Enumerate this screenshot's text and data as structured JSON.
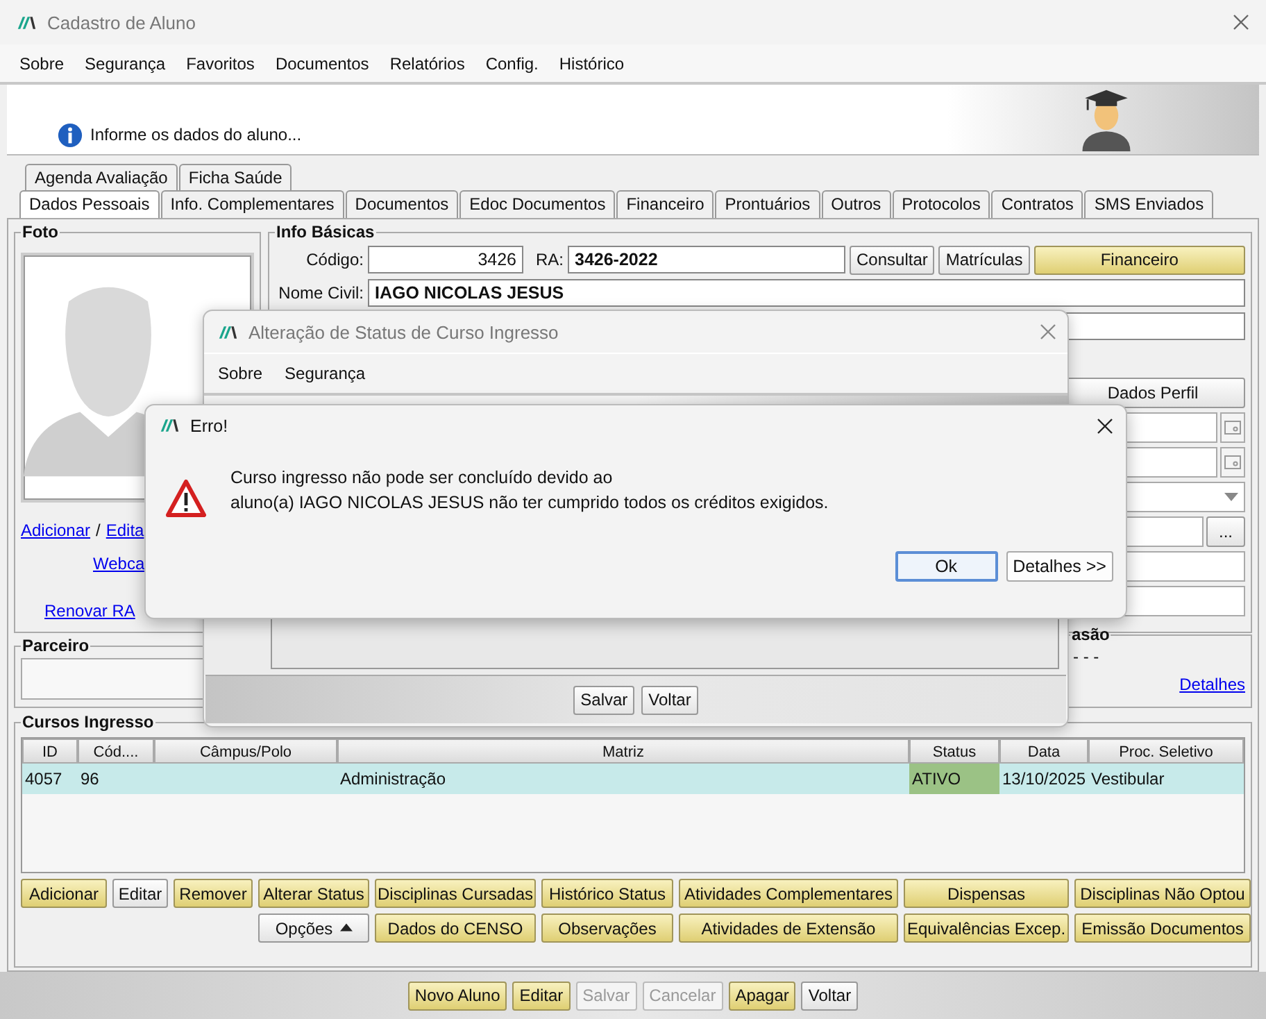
{
  "window": {
    "title": "Cadastro de Aluno"
  },
  "menu": [
    "Sobre",
    "Segurança",
    "Favoritos",
    "Documentos",
    "Relatórios",
    "Config.",
    "Histórico"
  ],
  "header": {
    "info": "Informe os dados do aluno..."
  },
  "tabs_row1": [
    {
      "label": "Agenda Avaliação",
      "selected": false
    },
    {
      "label": "Ficha Saúde",
      "selected": false
    }
  ],
  "tabs_row2": [
    {
      "label": "Dados Pessoais",
      "selected": true
    },
    {
      "label": "Info. Complementares",
      "selected": false
    },
    {
      "label": "Documentos",
      "selected": false
    },
    {
      "label": "Edoc Documentos",
      "selected": false
    },
    {
      "label": "Financeiro",
      "selected": false
    },
    {
      "label": "Prontuários",
      "selected": false
    },
    {
      "label": "Outros",
      "selected": false
    },
    {
      "label": "Protocolos",
      "selected": false
    },
    {
      "label": "Contratos",
      "selected": false
    },
    {
      "label": "SMS Enviados",
      "selected": false
    }
  ],
  "foto": {
    "title": "Foto",
    "link_add": "Adicionar",
    "separator": "/",
    "link_edit": "Edita",
    "link_webcam": "Webca",
    "link_renew": "Renovar RA"
  },
  "info_basicas": {
    "title": "Info Básicas",
    "codigo_label": "Código:",
    "codigo": "3426",
    "ra_label": "RA:",
    "ra": "3426-2022",
    "nome_label": "Nome Civil:",
    "nome": "IAGO NICOLAS JESUS",
    "buttons": [
      {
        "label": "Consultar",
        "kind": "plain"
      },
      {
        "label": "Matrículas",
        "kind": "plain"
      },
      {
        "label": "Financeiro",
        "kind": "yellow"
      }
    ]
  },
  "perfil": {
    "button": "Dados Perfil",
    "more": "...",
    "box_title": "asão",
    "value": "- - -",
    "link": "Detalhes"
  },
  "parceiro": {
    "title": "Parceiro"
  },
  "cursos": {
    "title": "Cursos Ingresso",
    "columns": [
      "ID",
      "Cód....",
      "Câmpus/Polo",
      "Matriz",
      "Status",
      "Data",
      "Proc. Seletivo"
    ],
    "rows": [
      {
        "cells": [
          "4057",
          "96",
          "",
          "Administração",
          "ATIVO",
          "13/10/2025",
          "Vestibular"
        ],
        "selected": true
      }
    ],
    "buttons_row1": [
      {
        "label": "Adicionar",
        "kind": "yellow"
      },
      {
        "label": "Editar",
        "kind": "plain"
      },
      {
        "label": "Remover",
        "kind": "yellow"
      },
      {
        "label": "Alterar Status",
        "kind": "yellow"
      },
      {
        "label": "Disciplinas Cursadas",
        "kind": "yellow"
      },
      {
        "label": "Histórico Status",
        "kind": "yellow"
      },
      {
        "label": "Atividades Complementares",
        "kind": "yellow"
      },
      {
        "label": "Dispensas",
        "kind": "yellow"
      },
      {
        "label": "Disciplinas Não Optou",
        "kind": "yellow"
      }
    ],
    "buttons_row2": [
      {
        "label": "Opções",
        "kind": "menu"
      },
      {
        "label": "Dados do CENSO",
        "kind": "yellow"
      },
      {
        "label": "Observações",
        "kind": "yellow"
      },
      {
        "label": "Atividades de Extensão",
        "kind": "yellow"
      },
      {
        "label": "Equivalências Excep.",
        "kind": "yellow"
      },
      {
        "label": "Emissão Documentos",
        "kind": "yellow"
      }
    ]
  },
  "footer_buttons": [
    {
      "label": "Novo Aluno",
      "kind": "yellow",
      "disabled": false
    },
    {
      "label": "Editar",
      "kind": "yellow",
      "disabled": false
    },
    {
      "label": "Salvar",
      "kind": "plain",
      "disabled": true
    },
    {
      "label": "Cancelar",
      "kind": "plain",
      "disabled": true
    },
    {
      "label": "Apagar",
      "kind": "yellow",
      "disabled": false
    },
    {
      "label": "Voltar",
      "kind": "plain",
      "disabled": false
    }
  ],
  "status_dialog": {
    "title": "Alteração de Status de Curso Ingresso",
    "menu": [
      "Sobre",
      "Segurança"
    ],
    "buttons": [
      "Salvar",
      "Voltar"
    ]
  },
  "error_dialog": {
    "title": "Erro!",
    "message": [
      "Curso ingresso não pode ser concluído devido ao",
      "aluno(a) IAGO NICOLAS JESUS não ter cumprido todos os créditos exigidos."
    ],
    "buttons": [
      {
        "label": "Ok",
        "default": true
      },
      {
        "label": "Detalhes >>",
        "default": false
      }
    ]
  }
}
